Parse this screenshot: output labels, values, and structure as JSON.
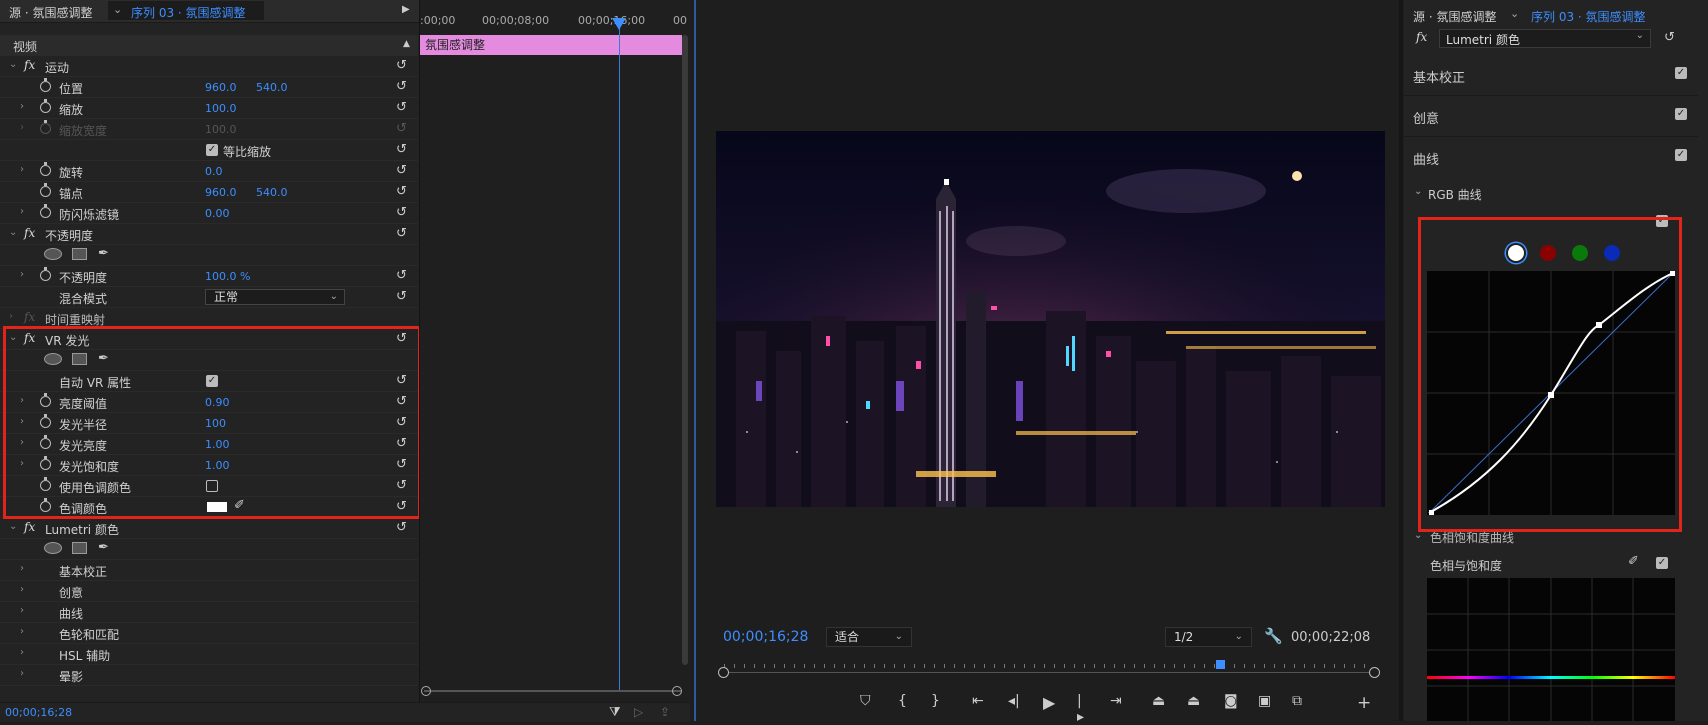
{
  "effect_controls": {
    "header": {
      "source_label": "源 · 氛围感调整",
      "sequence_label": "序列 03 · 氛围感调整"
    },
    "video_header": "视频",
    "motion": {
      "title": "运动",
      "position": {
        "label": "位置",
        "x": "960.0",
        "y": "540.0"
      },
      "scale": {
        "label": "缩放",
        "value": "100.0"
      },
      "scale_width": {
        "label": "缩放宽度",
        "value": "100.0"
      },
      "uniform_scale": "等比缩放",
      "rotation": {
        "label": "旋转",
        "value": "0.0"
      },
      "anchor": {
        "label": "锚点",
        "x": "960.0",
        "y": "540.0"
      },
      "antiflicker": {
        "label": "防闪烁滤镜",
        "value": "0.00"
      }
    },
    "opacity": {
      "title": "不透明度",
      "opacity": {
        "label": "不透明度",
        "value": "100.0 %"
      },
      "blend_mode": {
        "label": "混合模式",
        "value": "正常"
      }
    },
    "time_remap": "时间重映射",
    "vr_glow": {
      "title": "VR 发光",
      "auto_vr": "自动 VR 属性",
      "luma_threshold": {
        "label": "亮度阈值",
        "value": "0.90"
      },
      "glow_radius": {
        "label": "发光半径",
        "value": "100"
      },
      "glow_brightness": {
        "label": "发光亮度",
        "value": "1.00"
      },
      "glow_saturation": {
        "label": "发光饱和度",
        "value": "1.00"
      },
      "use_tint": "使用色调颜色",
      "tint_color": "色调颜色"
    },
    "lumetri": {
      "title": "Lumetri 颜色",
      "items": [
        "基本校正",
        "创意",
        "曲线",
        "色轮和匹配",
        "HSL 辅助",
        "晕影"
      ]
    },
    "timeline": {
      "ticks": [
        ":00;00",
        "00;00;08;00",
        "00;00;16;00",
        "00"
      ],
      "clip_label": "氛围感调整"
    },
    "bottom_timecode": "00;00;16;28"
  },
  "program_monitor": {
    "timecode": "00;00;16;28",
    "fit": "适合",
    "resolution": "1/2",
    "duration": "00;00;22;08"
  },
  "lumetri_panel": {
    "source_label": "源 · 氛围感调整",
    "sequence_label": "序列 03 · 氛围感调整",
    "effect_select": "Lumetri 颜色",
    "sections": [
      "基本校正",
      "创意",
      "曲线"
    ],
    "rgb_curves": "RGB 曲线",
    "hue_sat_curves": "色相饱和度曲线",
    "hue_vs_sat": "色相与饱和度",
    "channel_colors": [
      "#ffffff",
      "#8b0000",
      "#0a7a0a",
      "#0a2bb8"
    ]
  },
  "colors": {
    "accent": "#3d8eff",
    "highlight": "#e1251b",
    "clip": "#e48bdf"
  }
}
